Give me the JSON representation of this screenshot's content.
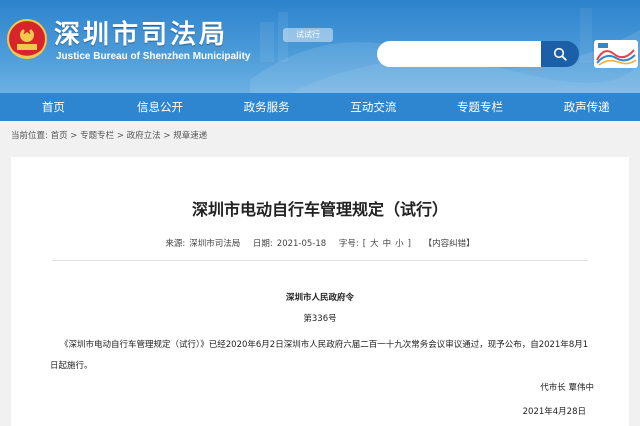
{
  "header": {
    "site_title": "深圳市司法局",
    "site_subtitle": "Justice Bureau of Shenzhen Municipality",
    "trial_badge": "试试行",
    "search_placeholder": "",
    "brand_color": "#2f86d0"
  },
  "nav": {
    "items": [
      {
        "label": "首页"
      },
      {
        "label": "信息公开"
      },
      {
        "label": "政务服务"
      },
      {
        "label": "互动交流"
      },
      {
        "label": "专题专栏"
      },
      {
        "label": "政声传递"
      }
    ]
  },
  "breadcrumb": {
    "prefix": "当前位置:",
    "items": [
      "首页",
      "专题专栏",
      "政府立法",
      "规章速递"
    ],
    "separator": ">"
  },
  "article": {
    "title": "深圳市电动自行车管理规定（试行）",
    "source_label": "来源:",
    "source": "深圳市司法局",
    "date_label": "日期:",
    "date": "2021-05-18",
    "font_size_label": "字号:",
    "font_size_open": "[",
    "font_large": "大",
    "font_medium": "中",
    "font_small": "小",
    "font_size_close": "]",
    "correction": "【内容纠错】",
    "order_title": "深圳市人民政府令",
    "order_no": "第336号",
    "body": "《深圳市电动自行车管理规定（试行）》已经2020年6月2日深圳市人民政府六届二百一十九次常务会议审议通过，现予公布，自2021年8月1日起施行。",
    "signature": "代市长  覃伟中",
    "sign_date": "2021年4月28日"
  }
}
